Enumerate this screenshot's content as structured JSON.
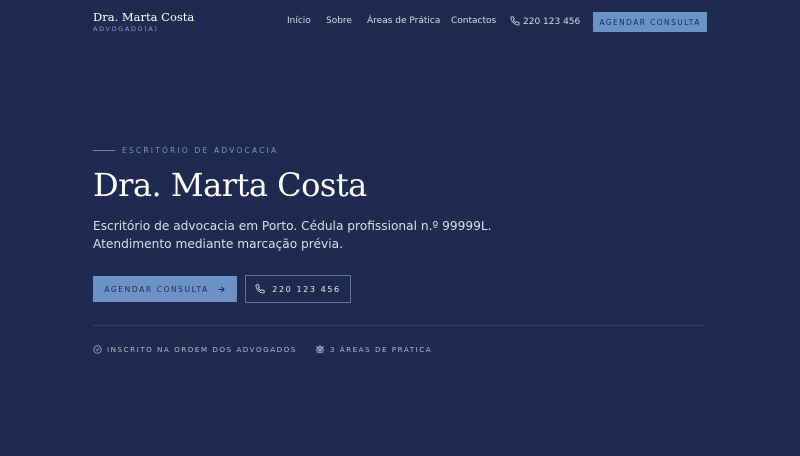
{
  "header": {
    "brand_name": "Dra. Marta Costa",
    "brand_subtitle": "ADVOGADO(A)",
    "nav": [
      {
        "label": "Início"
      },
      {
        "label": "Sobre"
      },
      {
        "label": "Áreas de Prática"
      },
      {
        "label": "Contactos"
      }
    ],
    "phone": "220 123 456",
    "phone_icon": "phone-icon",
    "cta_label": "AGENDAR CONSULTA"
  },
  "hero": {
    "eyebrow": "ESCRITÓRIO DE ADVOCACIA",
    "title": "Dra. Marta Costa",
    "lead_line1": "Escritório de advocacia em Porto. Cédula profissional n.º 99999L.",
    "lead_line2": "Atendimento mediante marcação prévia.",
    "primary_button": "AGENDAR CONSULTA",
    "primary_button_icon": "arrow-right-icon",
    "secondary_button": "220 123 456",
    "secondary_button_icon": "phone-icon"
  },
  "badges": [
    {
      "icon": "check-circle-icon",
      "label": "INSCRITO NA ORDEM DOS ADVOGADOS"
    },
    {
      "icon": "scale-icon",
      "label": "3 ÁREAS DE PRÁTICA"
    }
  ],
  "colors": {
    "background": "#1e2a4f",
    "accent": "#6d93c6",
    "eyebrow": "#7d95c4"
  }
}
